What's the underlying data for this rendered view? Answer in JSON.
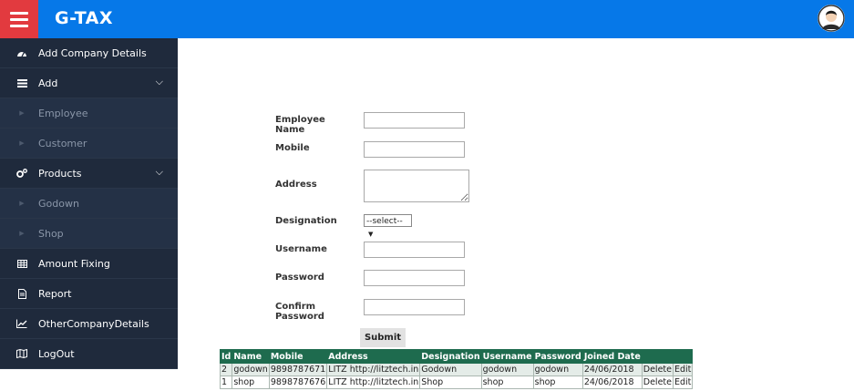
{
  "header": {
    "brand": "G-TAX"
  },
  "sidebar": {
    "items": [
      {
        "label": "Add Company Details",
        "icon": "dashboard-icon",
        "type": "main"
      },
      {
        "label": "Add",
        "icon": "list-icon",
        "type": "main",
        "expandable": true
      },
      {
        "label": "Employee",
        "type": "sub"
      },
      {
        "label": "Customer",
        "type": "sub"
      },
      {
        "label": "Products",
        "icon": "cogs-icon",
        "type": "main",
        "expandable": true
      },
      {
        "label": "Godown",
        "type": "sub"
      },
      {
        "label": "Shop",
        "type": "sub"
      },
      {
        "label": "Amount Fixing",
        "icon": "table-icon",
        "type": "main"
      },
      {
        "label": "Report",
        "icon": "file-icon",
        "type": "main"
      },
      {
        "label": "OtherCompanyDetails",
        "icon": "line-chart-icon",
        "type": "main"
      },
      {
        "label": "LogOut",
        "icon": "map-icon",
        "type": "main"
      }
    ]
  },
  "form": {
    "employee_name_label": "Employee Name",
    "employee_name_value": "",
    "mobile_label": "Mobile",
    "mobile_value": "",
    "address_label": "Address",
    "address_value": "",
    "designation_label": "Designation",
    "designation_selected": "--select--",
    "username_label": "Username",
    "username_value": "",
    "password_label": "Password",
    "password_value": "",
    "confirm_password_label": "Confirm Password",
    "confirm_password_value": "",
    "submit_label": "Submit"
  },
  "table": {
    "headers": [
      "Id",
      "Name",
      "Mobile",
      "Address",
      "Designation",
      "Username",
      "Password",
      "Joined Date",
      "",
      ""
    ],
    "rows": [
      [
        "2",
        "godown",
        "9898787671",
        "LITZ http://litztech.in",
        "Godown",
        "godown",
        "godown",
        "24/06/2018",
        "Delete",
        "Edit"
      ],
      [
        "1",
        "shop",
        "9898787676",
        "LITZ http://litztech.in",
        "Shop",
        "shop",
        "shop",
        "24/06/2018",
        "Delete",
        "Edit"
      ]
    ]
  },
  "colors": {
    "topbar": "#0678e8",
    "hamburger": "#e23a3f",
    "sidebar": "#1f2a3c",
    "table_header": "#1e6b4e"
  }
}
